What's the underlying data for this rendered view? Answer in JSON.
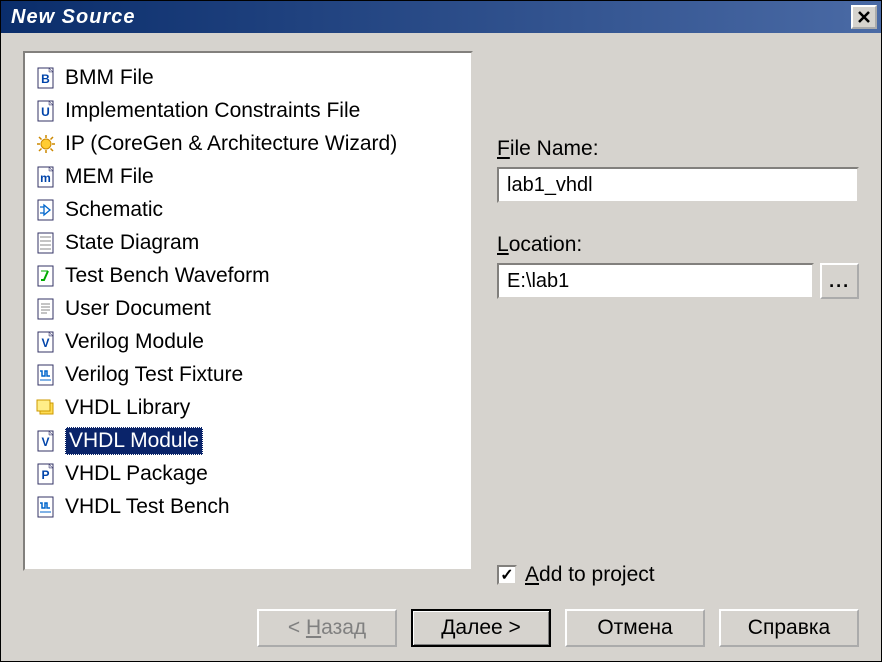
{
  "title": "New Source",
  "sourceTypes": [
    {
      "label": "BMM File",
      "icon": "doc-b"
    },
    {
      "label": "Implementation Constraints File",
      "icon": "doc-u"
    },
    {
      "label": "IP (CoreGen & Architecture Wizard)",
      "icon": "ip-wizard"
    },
    {
      "label": "MEM File",
      "icon": "doc-m"
    },
    {
      "label": "Schematic",
      "icon": "schematic"
    },
    {
      "label": "State Diagram",
      "icon": "state-diagram"
    },
    {
      "label": "Test Bench Waveform",
      "icon": "waveform"
    },
    {
      "label": "User Document",
      "icon": "doc-text"
    },
    {
      "label": "Verilog Module",
      "icon": "doc-v"
    },
    {
      "label": "Verilog Test Fixture",
      "icon": "doc-vt"
    },
    {
      "label": "VHDL Library",
      "icon": "vhdl-lib"
    },
    {
      "label": "VHDL Module",
      "icon": "doc-v",
      "selected": true
    },
    {
      "label": "VHDL Package",
      "icon": "doc-p"
    },
    {
      "label": "VHDL Test Bench",
      "icon": "doc-vtb"
    }
  ],
  "fields": {
    "fileName": {
      "label_pre": "F",
      "label_post": "ile Name:",
      "value": "lab1_vhdl"
    },
    "location": {
      "label_pre": "L",
      "label_post": "ocation:",
      "value": "E:\\lab1"
    },
    "browse": "..."
  },
  "checkbox": {
    "checked": true,
    "label_pre": "A",
    "label_post": "dd to project",
    "check_glyph": "✓"
  },
  "buttons": {
    "back": "< Назад",
    "next": "Далее >",
    "cancel": "Отмена",
    "help": "Справка"
  }
}
